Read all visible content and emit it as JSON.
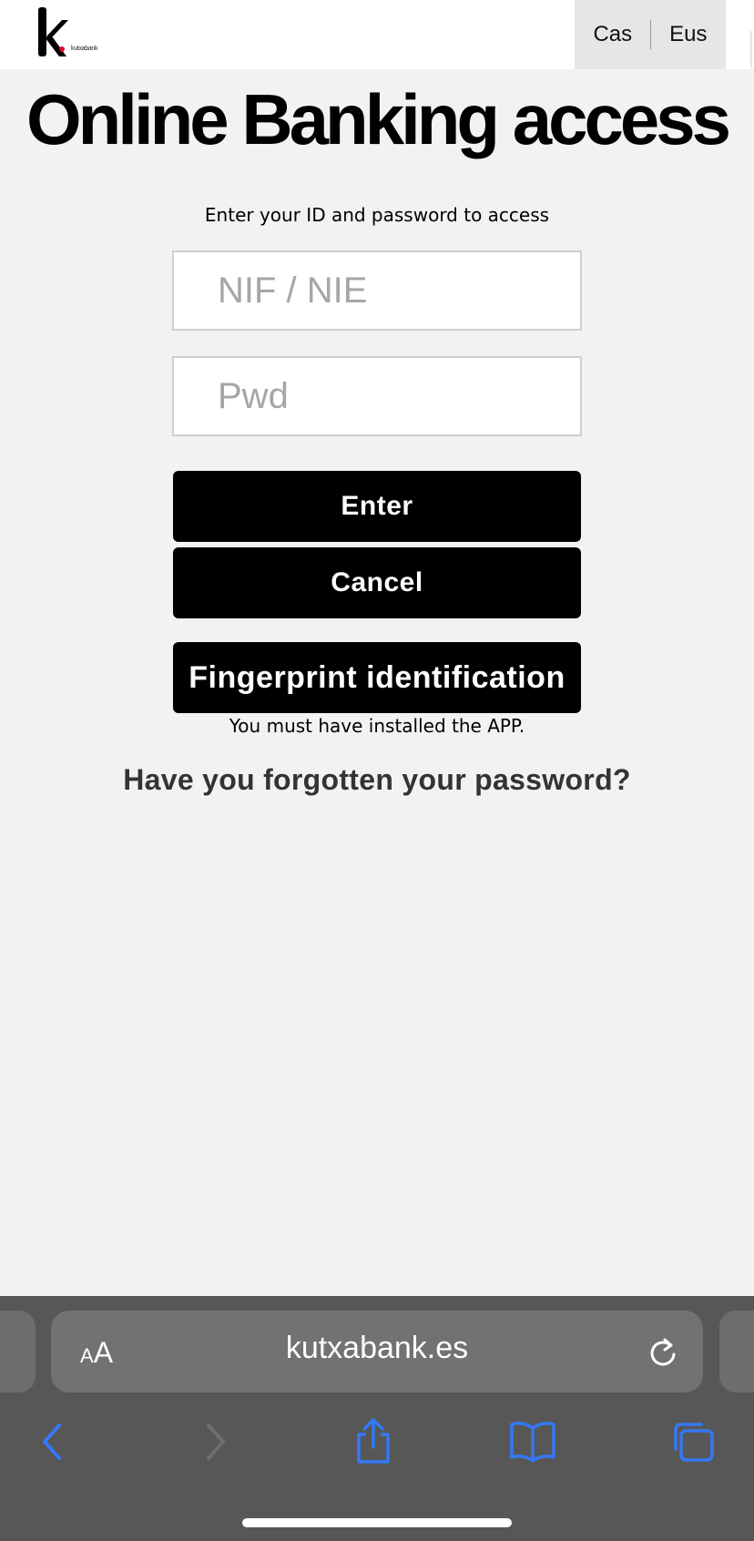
{
  "header": {
    "logo_text": "kutxabank",
    "lang_options": [
      "Cas",
      "Eus"
    ]
  },
  "main": {
    "title": "Online Banking access",
    "subtitle": "Enter your ID and password to access",
    "id_placeholder": "NIF / NIE",
    "password_placeholder": "Pwd",
    "enter_label": "Enter",
    "cancel_label": "Cancel",
    "fingerprint_label": "Fingerprint identification",
    "fingerprint_note": "You must have installed the APP.",
    "forgot_label": "Have you forgotten your password?"
  },
  "browser": {
    "text_size_small": "A",
    "text_size_large": "A",
    "url": "kutxabank.es",
    "icons": [
      "back-icon",
      "forward-icon",
      "share-icon",
      "bookmarks-icon",
      "tabs-icon",
      "reload-icon"
    ],
    "accent_color": "#3478f6"
  },
  "colors": {
    "page_bg": "#f2f2f2",
    "button_bg": "#000000",
    "toolbar_bg": "#575757"
  }
}
